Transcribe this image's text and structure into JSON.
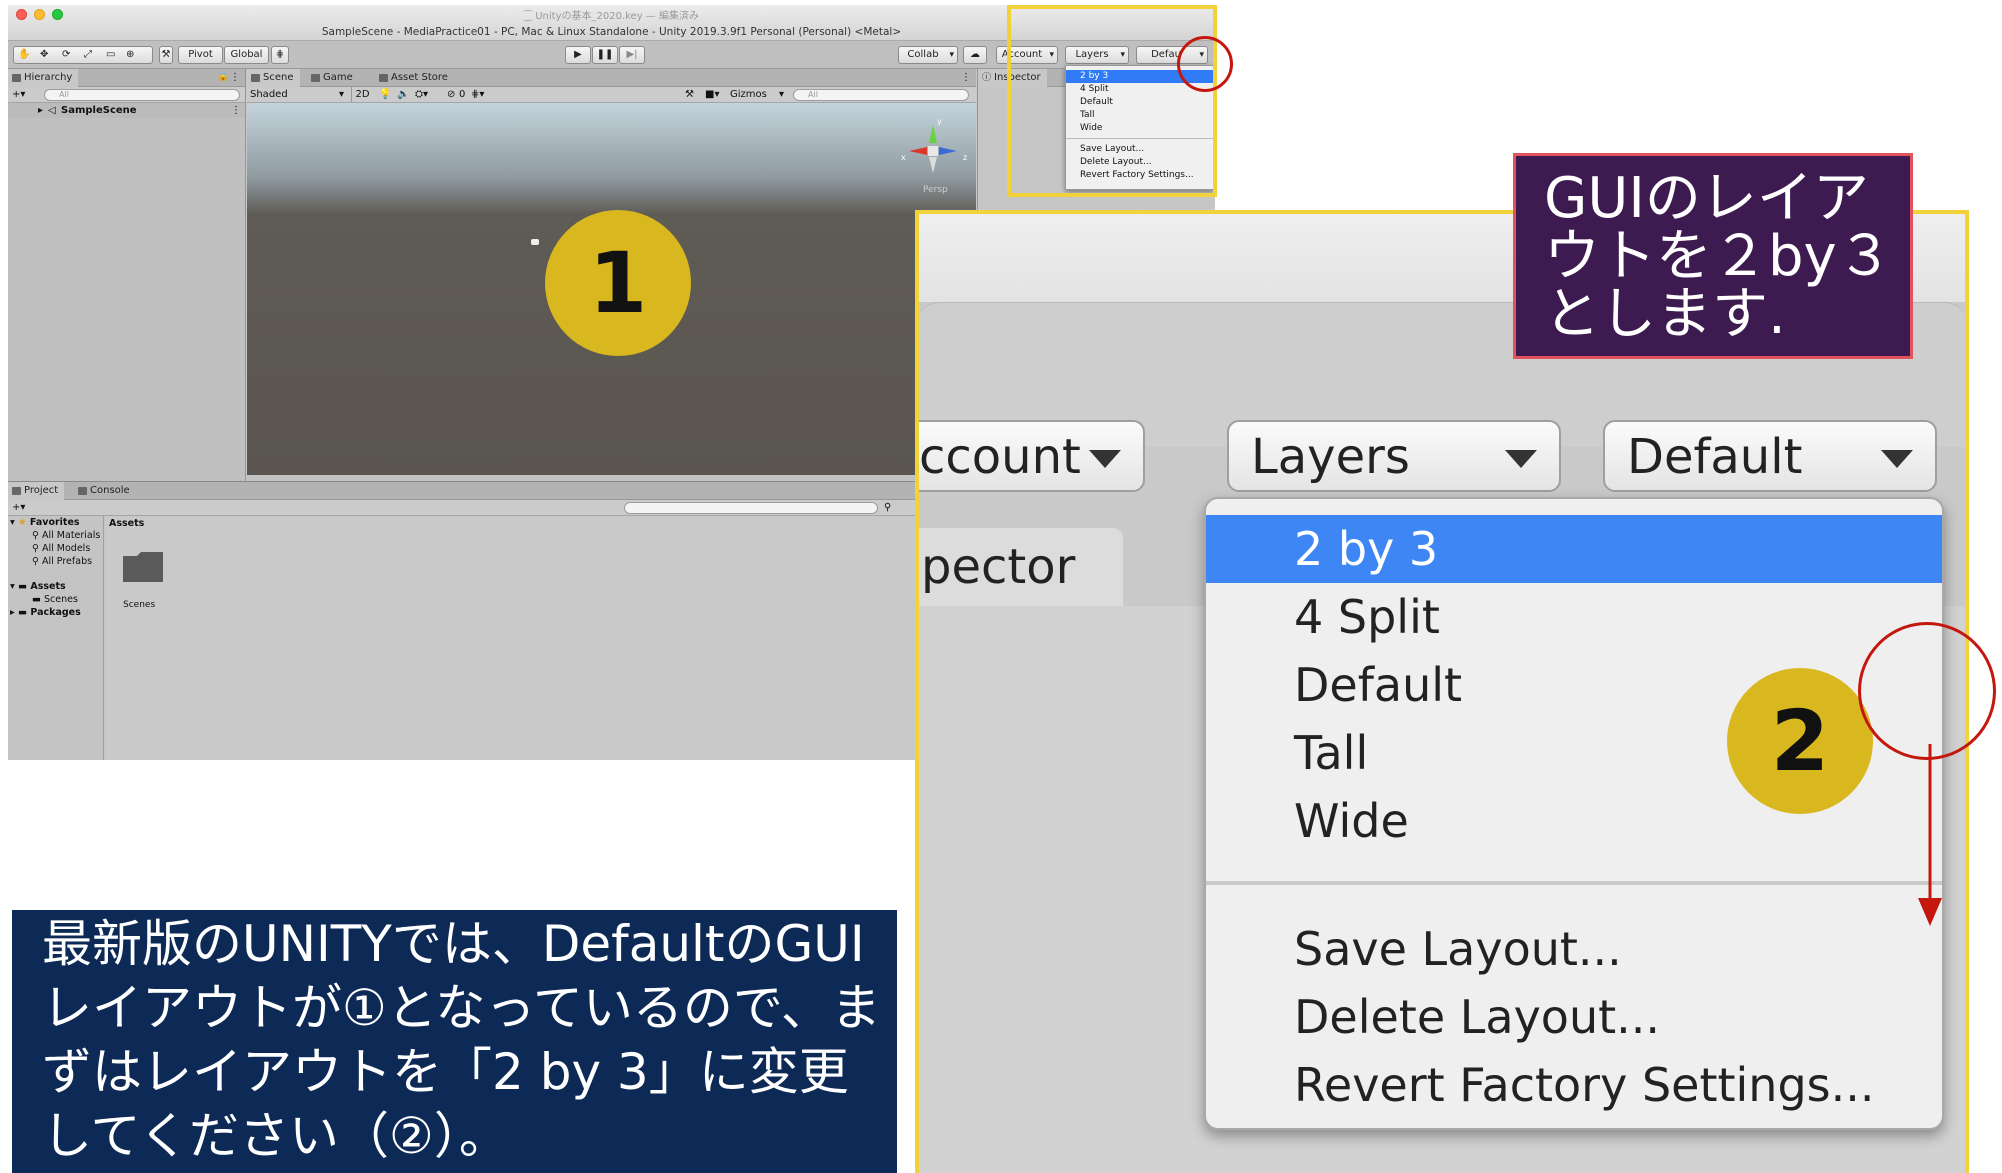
{
  "window": {
    "doc_line": "⁐ Unityの基本_2020.key — 編集済み",
    "title": "SampleScene - MediaPractice01 - PC, Mac & Linux Standalone - Unity 2019.3.9f1 Personal (Personal) <Metal>"
  },
  "toolbar": {
    "pivot": "Pivot",
    "global": "Global",
    "collab": "Collab",
    "account": "Account",
    "layers": "Layers",
    "layout": "Defau"
  },
  "hierarchy": {
    "tab": "Hierarchy",
    "search_placeholder": "All",
    "root_item": "SampleScene"
  },
  "scene": {
    "tabs": [
      "Scene",
      "Game",
      "Asset Store"
    ],
    "shading_mode": "Shaded",
    "mode_2d": "2D",
    "fx_count": "0",
    "gizmos": "Gizmos",
    "search_placeholder": "All",
    "persp_label": "Persp",
    "gizmo_axes": [
      "y",
      "x",
      "z"
    ]
  },
  "inspector": {
    "tab": "Inspector"
  },
  "project": {
    "tabs": [
      "Project",
      "Console"
    ],
    "favorites": {
      "label": "Favorites",
      "items": [
        "All Materials",
        "All Models",
        "All Prefabs"
      ]
    },
    "assets": {
      "label": "Assets",
      "items": [
        "Scenes"
      ]
    },
    "packages": "Packages",
    "breadcrumb": "Assets",
    "folder_name": "Scenes"
  },
  "layout_menu": {
    "items": [
      "2 by 3",
      "4 Split",
      "Default",
      "Tall",
      "Wide"
    ],
    "actions": [
      "Save Layout...",
      "Delete Layout...",
      "Revert Factory Settings..."
    ],
    "selected": "2 by 3"
  },
  "zoom": {
    "account": "ccount",
    "layers": "Layers",
    "default": "Default",
    "inspector_tab": "pector"
  },
  "annotations": {
    "badge1": "1",
    "badge2": "2",
    "caption_top": "GUIのレイアウトを２by３とします.",
    "caption_bottom": "最新版のUNITYでは、DefaultのGUIレイアウトが①となっているので、まずはレイアウトを「2 by 3」に変更してください（②）。",
    "colors": {
      "badge": "#d9b71f",
      "highlight": "#f1d23a",
      "circle": "#c4170d",
      "caption_top_bg": "#3d1a4f",
      "caption_bottom_bg": "#0d2a57",
      "selection": "#3d86f4"
    }
  }
}
